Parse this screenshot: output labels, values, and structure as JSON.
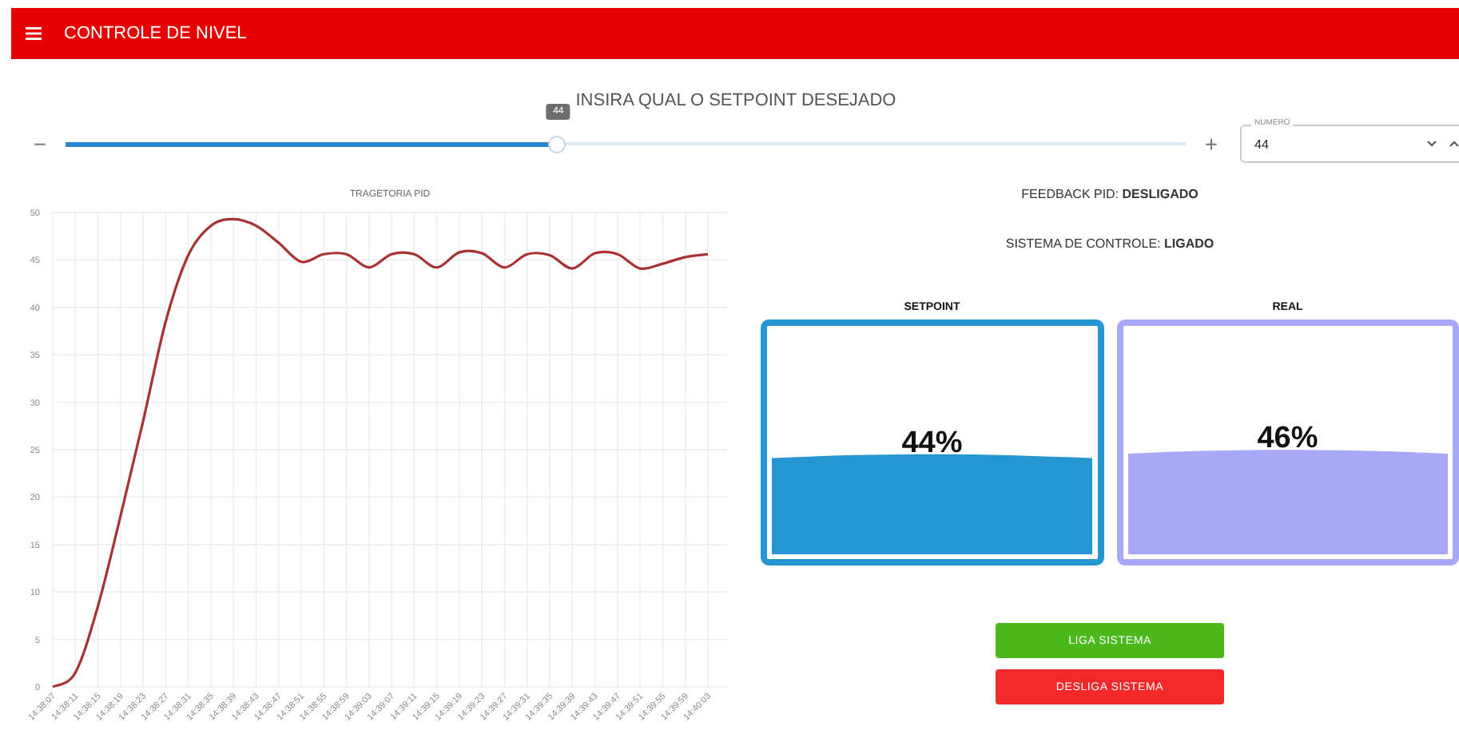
{
  "app_bar": {
    "title": "CONTROLE DE NIVEL"
  },
  "setpoint_input": {
    "prompt": "INSIRA QUAL O SETPOINT DESEJADO",
    "minus": "−",
    "plus": "+",
    "tooltip": "44",
    "level": 0.44,
    "number_label": "NUMERO",
    "number_value": "44"
  },
  "chart": {
    "chart_data": {
      "type": "line",
      "title": "TRAGETORIA PID",
      "categories": [
        "14:38:07",
        "14:38:11",
        "14:38:15",
        "14:38:19",
        "14:38:23",
        "14:38:27",
        "14:38:31",
        "14:38:35",
        "14:38:39",
        "14:38:43",
        "14:38:47",
        "14:38:51",
        "14:38:55",
        "14:38:59",
        "14:39:03",
        "14:39:07",
        "14:39:11",
        "14:39:15",
        "14:39:19",
        "14:39:23",
        "14:39:27",
        "14:39:31",
        "14:39:35",
        "14:39:39",
        "14:39:43",
        "14:39:47",
        "14:39:51",
        "14:39:55",
        "14:39:59",
        "14:40:03"
      ],
      "series": [
        {
          "color": "#a83232",
          "values": [
            0,
            1.5,
            8.5,
            18,
            28,
            38.5,
            45.5,
            48.6,
            49.3,
            48.6,
            46.8,
            44.8,
            45.6,
            45.6,
            44.2,
            45.6,
            45.6,
            44.2,
            45.8,
            45.7,
            44.2,
            45.6,
            45.5,
            44.1,
            45.7,
            45.6,
            44.1,
            44.6,
            45.3,
            45.6
          ]
        }
      ],
      "grid": true,
      "ylim": [
        0,
        50
      ],
      "yticks": [
        0,
        5,
        10,
        15,
        20,
        25,
        30,
        35,
        40,
        45,
        50
      ]
    }
  },
  "status": [
    {
      "label": "FEEDBACK PID:",
      "value": "DESLIGADO"
    },
    {
      "label": "SISTEMA DE CONTROLE:",
      "value": "LIGADO"
    }
  ],
  "tanks": [
    {
      "title": "SETPOINT",
      "reading": "44%",
      "color": "#2596d1"
    },
    {
      "title": "REAL",
      "reading": "46%",
      "color": "#a8a8f8"
    }
  ],
  "buttons": [
    {
      "label": "LIGA SISTEMA",
      "kind": "on"
    },
    {
      "label": "DESLIGA SISTEMA",
      "kind": "off"
    }
  ]
}
